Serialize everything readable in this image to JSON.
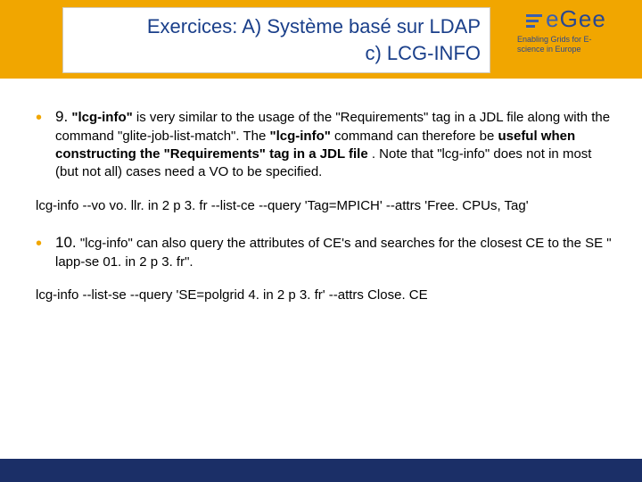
{
  "header": {
    "title_line1": "Exercices: A) Système basé sur LDAP",
    "title_line2": "c) LCG-INFO"
  },
  "logo": {
    "brand": "eGee",
    "tagline": "Enabling Grids for E-science in Europe"
  },
  "items": [
    {
      "num": "9.",
      "lead_bold": "\"lcg-info\"",
      "lead_rest": " is very similar to the usage of the \"Requirements\" tag in a JDL file along with the command \"glite-job-list-match\". The ",
      "mid_bold": "\"lcg-info\"",
      "mid_rest": " command can therefore be ",
      "emph_bold": "useful when constructing the \"Requirements\" tag in a JDL file",
      "trail": ". Note that \"lcg-info\" does not in most (but not all) cases need a VO to be specified."
    },
    {
      "num": "10.",
      "lead_bold": "",
      "lead_rest": "\"lcg-info\" can also query the attributes of CE's and searches for the closest CE to the SE \" lapp-se 01. in 2 p 3. fr\".",
      "mid_bold": "",
      "mid_rest": "",
      "emph_bold": "",
      "trail": ""
    }
  ],
  "commands": [
    "lcg-info --vo vo. llr. in 2 p 3. fr --list-ce --query 'Tag=MPICH' --attrs 'Free. CPUs, Tag'",
    "lcg-info --list-se --query 'SE=polgrid 4. in 2 p 3. fr' --attrs Close. CE"
  ]
}
